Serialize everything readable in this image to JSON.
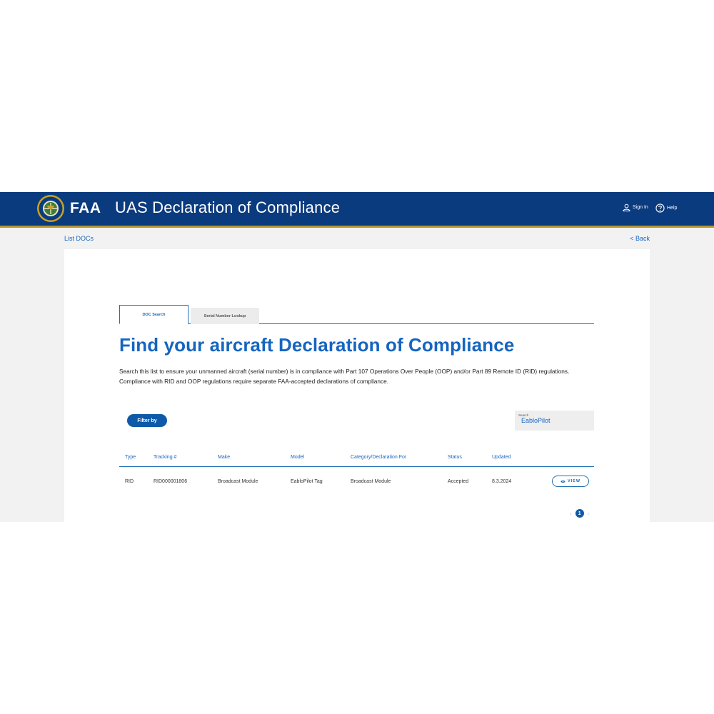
{
  "header": {
    "seal_text": "FEDERAL AVIATION ADMINISTRATION",
    "brand": "FAA",
    "app_title": "UAS Declaration of Compliance",
    "sign_in": "Sign In",
    "help": "Help"
  },
  "breadcrumb": {
    "current": "List DOCs",
    "back": "< Back"
  },
  "tabs": [
    {
      "label": "DOC Search",
      "active": true
    },
    {
      "label": "Serial Number Lookup",
      "active": false
    }
  ],
  "main": {
    "title": "Find your aircraft Declaration of Compliance",
    "description": "Search this list to ensure your unmanned aircraft (serial number) is in compliance with Part 107 Operations Over People (OOP) and/or Part 89 Remote ID (RID) regulations. Compliance with RID and OOP regulations require separate FAA-accepted declarations of compliance.",
    "filter_label": "Filter by",
    "search": {
      "label": "Search",
      "value": "EabloPilot"
    }
  },
  "table": {
    "columns": [
      "Type",
      "Tracking #",
      "Make",
      "Model",
      "Category/Declaration For",
      "Status",
      "Updated"
    ],
    "rows": [
      {
        "type": "RID",
        "tracking": "RID000001806",
        "make": "Broadcast Module",
        "model": "EabloPilot Tag",
        "category": "Broadcast Module",
        "status": "Accepted",
        "updated": "8.3.2024",
        "action": "VIEW"
      }
    ]
  },
  "pagination": {
    "prev": "‹",
    "current_page": "1",
    "next": "›"
  },
  "colors": {
    "header_bg": "#0b3b7f",
    "header_accent": "#b6992d",
    "link_blue": "#1565c0",
    "button_blue": "#0f5aa8",
    "page_bg": "#f2f2f2"
  }
}
